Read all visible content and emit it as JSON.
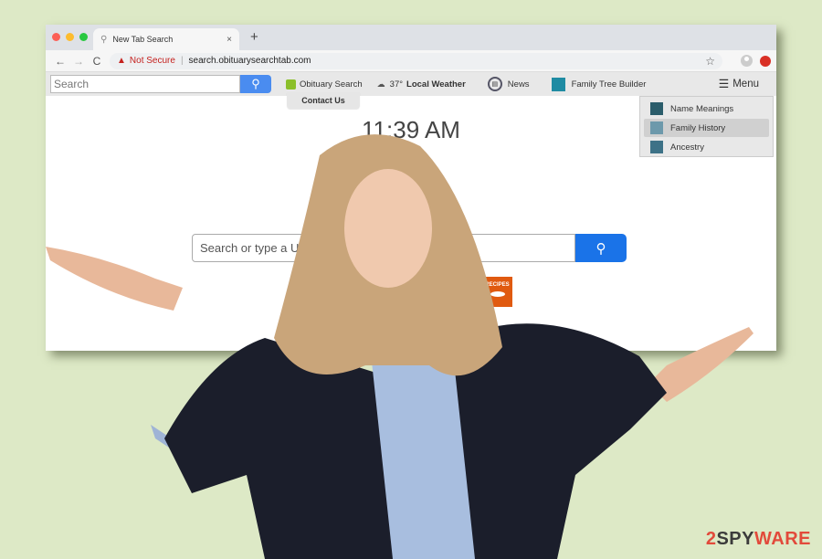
{
  "browser": {
    "traffic_lights": [
      "#fc5f57",
      "#fdbc2e",
      "#28c840"
    ],
    "tab": {
      "title": "New Tab Search",
      "icon": "search-icon",
      "close": "×"
    },
    "new_tab": "+",
    "nav": {
      "back": "←",
      "forward": "→",
      "reload": "C"
    },
    "address": {
      "security_label": "Not Secure",
      "url": "search.obituarysearchtab.com",
      "warning_icon": "▲"
    }
  },
  "toolbar": {
    "search_placeholder": "Search",
    "items": [
      {
        "label": "Obituary Search",
        "icon": "obituary-icon"
      },
      {
        "temp": "37°",
        "label": "Local Weather",
        "icon": "weather-icon"
      },
      {
        "label": "News",
        "icon": "news-icon"
      },
      {
        "label": "Family Tree Builder",
        "icon": "folder-icon"
      }
    ],
    "menu_label": "Menu",
    "contact_label": "Contact Us",
    "menu_items": [
      {
        "label": "Name Meanings",
        "color": "#2b5d6b"
      },
      {
        "label": "Family History",
        "color": "#6d99ab",
        "active": true
      },
      {
        "label": "Ancestry",
        "color": "#3d7287"
      }
    ]
  },
  "page": {
    "time": "11:39 AM",
    "search_placeholder": "Search or type a URL",
    "tiles": [
      {
        "label": "",
        "color": "#5cb82f"
      },
      {
        "label": "RECIPES",
        "color": "#e05a10"
      }
    ]
  },
  "watermark": {
    "prefix": "2",
    "part1": "SPY",
    "part2": "WAR",
    "suffix": "E"
  }
}
